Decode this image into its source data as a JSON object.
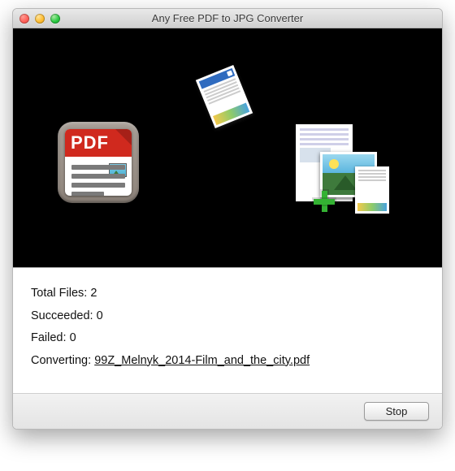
{
  "window": {
    "title": "Any Free PDF to JPG Converter"
  },
  "stage": {
    "pdf_band_label": "PDF"
  },
  "status": {
    "total_label": "Total Files:",
    "total_value": "2",
    "succeeded_label": "Succeeded:",
    "succeeded_value": "0",
    "failed_label": "Failed:",
    "failed_value": "0",
    "converting_label": "Converting:",
    "converting_file": "99Z_Melnyk_2014-Film_and_the_city.pdf"
  },
  "footer": {
    "stop_label": "Stop"
  }
}
